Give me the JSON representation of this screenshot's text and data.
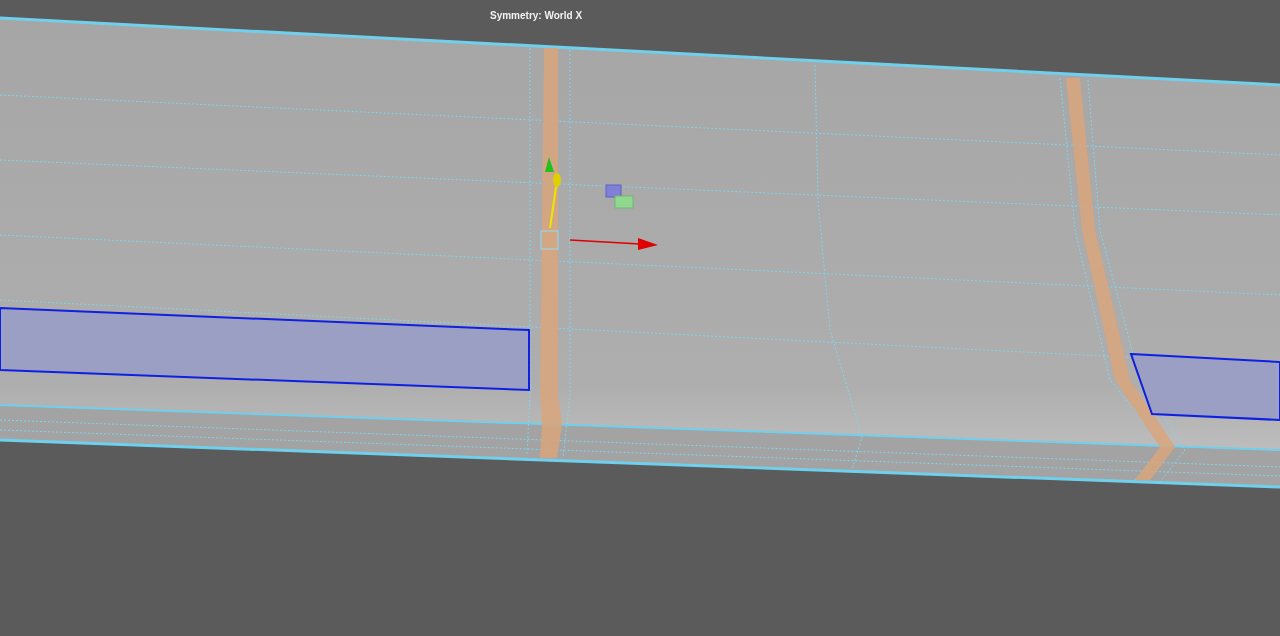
{
  "viewport": {
    "hud_label": "Symmetry: World X"
  }
}
